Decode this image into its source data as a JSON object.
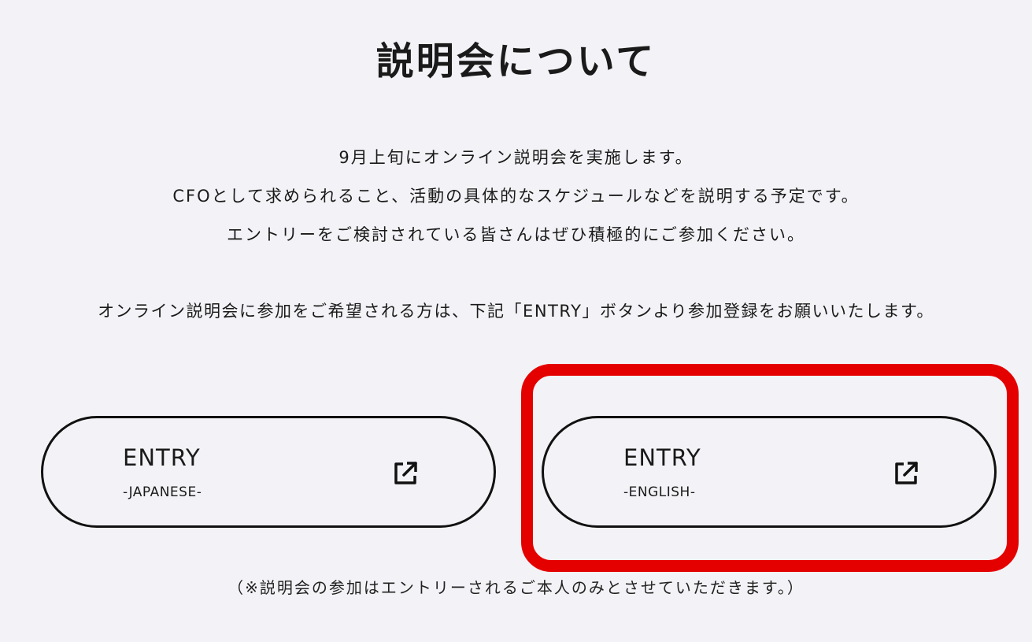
{
  "page_title": "説明会について",
  "intro_lines": [
    "9月上旬にオンライン説明会を実施します。",
    "CFOとして求められること、活動の具体的なスケジュールなどを説明する予定です。",
    "エントリーをご検討されている皆さんはぜひ積極的にご参加ください。"
  ],
  "notice": "オンライン説明会に参加をご希望される方は、下記「ENTRY」ボタンより参加登録をお願いいたします。",
  "buttons": [
    {
      "title": "ENTRY",
      "subtitle": "-JAPANESE-",
      "icon": "external-link-icon"
    },
    {
      "title": "ENTRY",
      "subtitle": "-ENGLISH-",
      "icon": "external-link-icon",
      "highlighted": true
    }
  ],
  "footnote": "（※説明会の参加はエントリーされるご本人のみとさせていただきます。）",
  "colors": {
    "background": "#f3f3f7",
    "text": "#1a1a1a",
    "highlight": "#e50000"
  }
}
